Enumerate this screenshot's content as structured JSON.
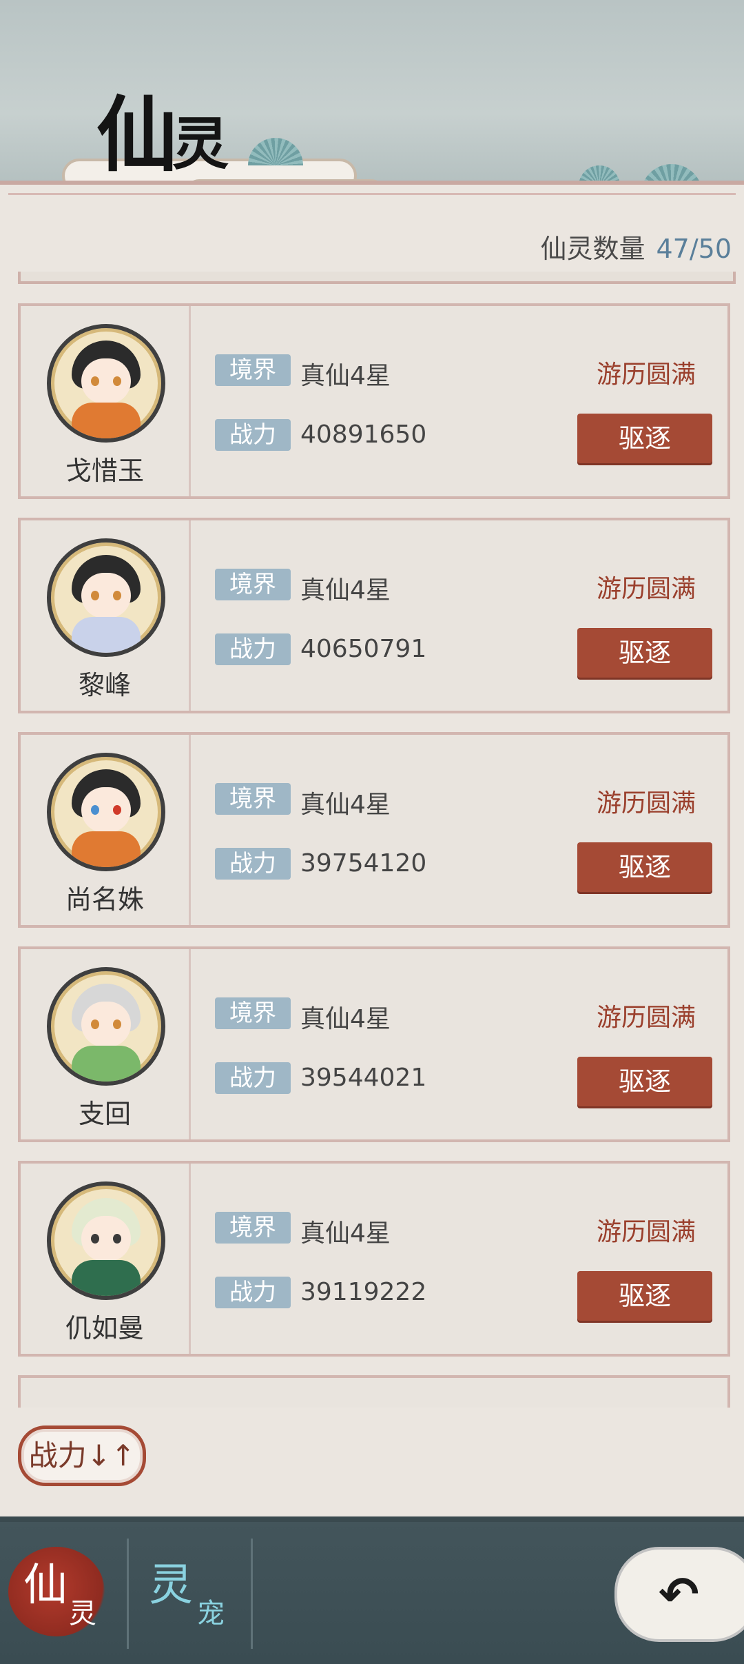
{
  "header": {
    "title_big": "仙",
    "title_small": "灵"
  },
  "summary": {
    "count_label": "仙灵数量",
    "count_value": "47/50"
  },
  "labels": {
    "realm": "境界",
    "power": "战力"
  },
  "spirits": [
    {
      "name": "戈惜玉",
      "realm": "真仙4星",
      "power": "40891650",
      "status": "游历圆满",
      "action": "驱逐",
      "hair": "#2b2b2b",
      "outfit": "#e07a32"
    },
    {
      "name": "黎峰",
      "realm": "真仙4星",
      "power": "40650791",
      "status": "游历圆满",
      "action": "驱逐",
      "hair": "#2b2b2b",
      "outfit": "#c9d2ea"
    },
    {
      "name": "尚名姝",
      "realm": "真仙4星",
      "power": "39754120",
      "status": "游历圆满",
      "action": "驱逐",
      "hair": "#2b2b2b",
      "outfit": "#e07a32"
    },
    {
      "name": "支回",
      "realm": "真仙4星",
      "power": "39544021",
      "status": "游历圆满",
      "action": "驱逐",
      "hair": "#d7d7d7",
      "outfit": "#7bb86a"
    },
    {
      "name": "仉如曼",
      "realm": "真仙4星",
      "power": "39119222",
      "status": "游历圆满",
      "action": "驱逐",
      "hair": "#e3ead0",
      "outfit": "#2f6e4e"
    }
  ],
  "sort": {
    "label": "战力↓↑"
  },
  "nav": {
    "tab1_big": "仙",
    "tab1_small": "灵",
    "tab2_big": "灵",
    "tab2_small": "宠"
  },
  "colors": {
    "accent_red": "#a54a35",
    "tag_blue": "#9fb7c6",
    "count_blue": "#5a7f9a"
  }
}
